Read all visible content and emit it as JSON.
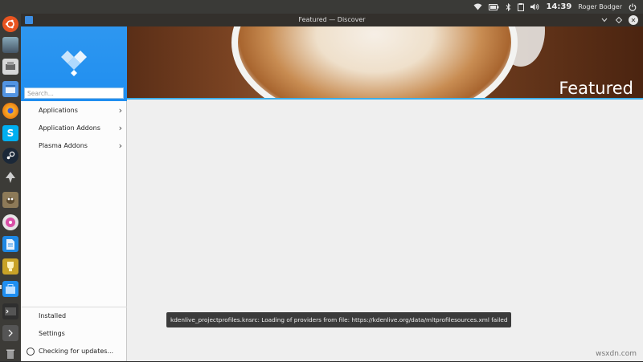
{
  "system_bar": {
    "clock": "14:39",
    "user": "Roger Bodger",
    "icons": [
      "wifi-icon",
      "battery-icon",
      "bluetooth-icon",
      "clipboard-icon",
      "volume-icon",
      "power-icon"
    ]
  },
  "window": {
    "title": "Featured — Discover"
  },
  "sidebar": {
    "search_placeholder": "Search...",
    "nav": [
      {
        "label": "Applications"
      },
      {
        "label": "Application Addons"
      },
      {
        "label": "Plasma Addons"
      }
    ],
    "bottom": {
      "installed": "Installed",
      "settings": "Settings",
      "status": "Checking for updates..."
    }
  },
  "banner": {
    "title": "Featured"
  },
  "toast": {
    "message": "kdenlive_projectprofiles.knsrc: Loading of providers from file: https://kdenlive.org/data/mltprofilesources.xml failed"
  },
  "watermark": "wsxdn.com",
  "colors": {
    "accent": "#3daee9",
    "sidebar_header": "#1f8ef0",
    "launcher": "#3c3b37"
  }
}
